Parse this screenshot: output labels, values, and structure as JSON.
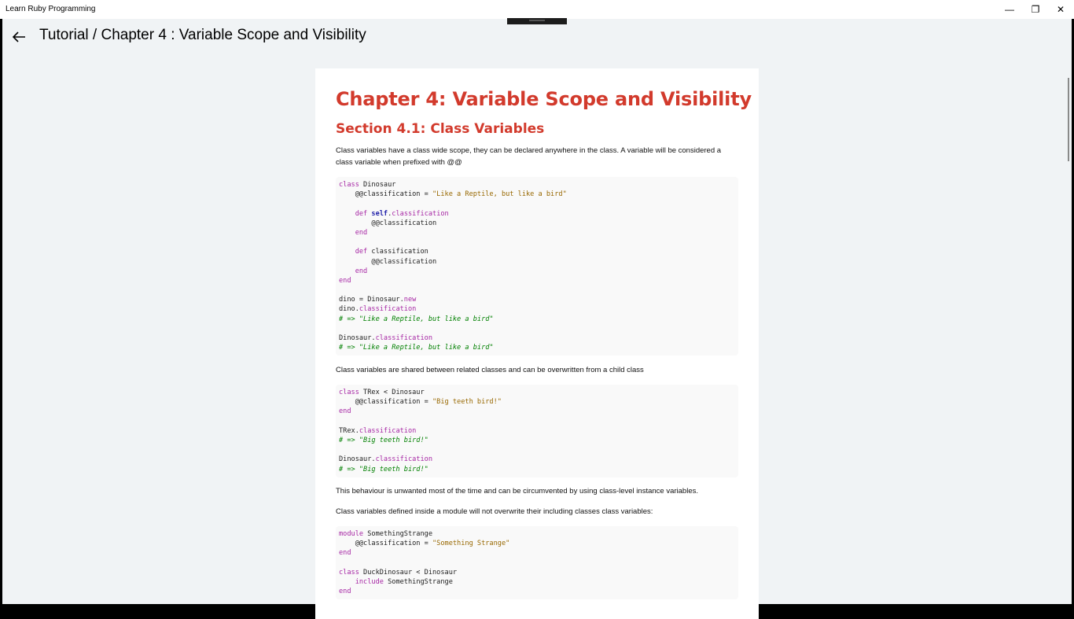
{
  "window": {
    "app_title": "Learn Ruby Programming",
    "minimize_glyph": "—",
    "maximize_glyph": "❐",
    "close_glyph": "✕"
  },
  "header": {
    "title": "Tutorial / Chapter 4 :  Variable Scope and Visibility"
  },
  "content": {
    "chapter_title": "Chapter 4: Variable Scope and Visibility",
    "section_title": "Section 4.1: Class Variables",
    "p1": "Class variables have a class wide scope, they can be declared anywhere in the class. A variable will be considered a class variable when prefixed with @@",
    "p2": "Class variables are shared between related classes and can be overwritten from a child class",
    "p3": "This behaviour is unwanted most of the time and can be circumvented by using class-level instance variables.",
    "p4": "Class variables defined inside a module will not overwrite their including classes class variables:",
    "code1": [
      [
        [
          "kw",
          "class"
        ],
        [
          "t",
          " Dinosaur"
        ]
      ],
      [
        [
          "t",
          "    @@classification = "
        ],
        [
          "str",
          "\"Like a Reptile, but like a bird\""
        ]
      ],
      [],
      [
        [
          "t",
          "    "
        ],
        [
          "kw",
          "def "
        ],
        [
          "self",
          "self"
        ],
        [
          "t",
          "."
        ],
        [
          "meth",
          "classification"
        ]
      ],
      [
        [
          "t",
          "        @@classification"
        ]
      ],
      [
        [
          "t",
          "    "
        ],
        [
          "kw",
          "end"
        ]
      ],
      [],
      [
        [
          "t",
          "    "
        ],
        [
          "kw",
          "def"
        ],
        [
          "t",
          " classification"
        ]
      ],
      [
        [
          "t",
          "        @@classification"
        ]
      ],
      [
        [
          "t",
          "    "
        ],
        [
          "kw",
          "end"
        ]
      ],
      [
        [
          "kw",
          "end"
        ]
      ],
      [],
      [
        [
          "t",
          "dino = Dinosaur."
        ],
        [
          "meth",
          "new"
        ]
      ],
      [
        [
          "t",
          "dino."
        ],
        [
          "meth",
          "classification"
        ]
      ],
      [
        [
          "cmt",
          "# => \"Like a Reptile, but like a bird\""
        ]
      ],
      [],
      [
        [
          "t",
          "Dinosaur."
        ],
        [
          "meth",
          "classification"
        ]
      ],
      [
        [
          "cmt",
          "# => \"Like a Reptile, but like a bird\""
        ]
      ]
    ],
    "code2": [
      [
        [
          "kw",
          "class"
        ],
        [
          "t",
          " TRex < Dinosaur"
        ]
      ],
      [
        [
          "t",
          "    @@classification = "
        ],
        [
          "str",
          "\"Big teeth bird!\""
        ]
      ],
      [
        [
          "kw",
          "end"
        ]
      ],
      [],
      [
        [
          "t",
          "TRex."
        ],
        [
          "meth",
          "classification"
        ]
      ],
      [
        [
          "cmt",
          "# => \"Big teeth bird!\""
        ]
      ],
      [],
      [
        [
          "t",
          "Dinosaur."
        ],
        [
          "meth",
          "classification"
        ]
      ],
      [
        [
          "cmt",
          "# => \"Big teeth bird!\""
        ]
      ]
    ],
    "code3": [
      [
        [
          "kw",
          "module"
        ],
        [
          "t",
          " SomethingStrange"
        ]
      ],
      [
        [
          "t",
          "    @@classification = "
        ],
        [
          "str",
          "\"Something Strange\""
        ]
      ],
      [
        [
          "kw",
          "end"
        ]
      ],
      [],
      [
        [
          "kw",
          "class"
        ],
        [
          "t",
          " DuckDinosaur < Dinosaur"
        ]
      ],
      [
        [
          "t",
          "    "
        ],
        [
          "kw",
          "include"
        ],
        [
          "t",
          " SomethingStrange"
        ]
      ],
      [
        [
          "kw",
          "end"
        ]
      ]
    ]
  }
}
